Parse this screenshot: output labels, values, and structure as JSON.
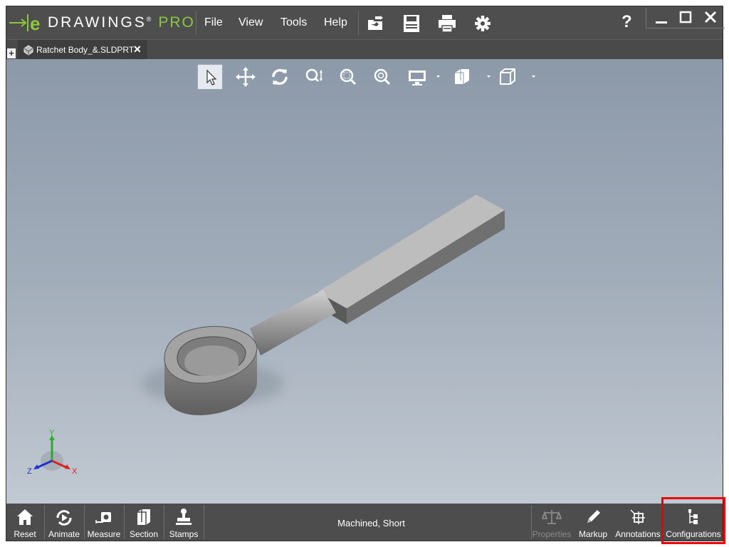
{
  "app": {
    "brand_word": "DRAWINGS",
    "brand_edition": "PRO",
    "registered_mark": "®",
    "accent_color": "#8dc63f"
  },
  "menu": {
    "file": "File",
    "view": "View",
    "tools": "Tools",
    "help": "Help"
  },
  "toolbar_icons": [
    "open-icon",
    "save-icon",
    "print-icon",
    "gear-icon"
  ],
  "help_label": "?",
  "tabs": [
    {
      "label": "Ratchet Body_&.SLDPRT",
      "close": "✕"
    }
  ],
  "new_tab_label": "+",
  "view_tools": [
    "select-icon",
    "pan-icon",
    "rotate-icon",
    "zoom-icon",
    "zoom-to-area-icon",
    "zoom-to-fit-icon",
    "display-style-icon",
    "section-view-icon",
    "standard-views-icon"
  ],
  "triad": {
    "x": "X",
    "y": "Y",
    "z": "Z"
  },
  "bottom_left": [
    {
      "label": "Reset",
      "icon": "home-icon"
    },
    {
      "label": "Animate",
      "icon": "animate-icon"
    },
    {
      "label": "Measure",
      "icon": "measure-icon"
    },
    {
      "label": "Section",
      "icon": "section-icon"
    },
    {
      "label": "Stamps",
      "icon": "stamp-icon"
    }
  ],
  "status_text": "Machined, Short",
  "bottom_right": [
    {
      "label": "Properties",
      "icon": "scale-icon",
      "disabled": true
    },
    {
      "label": "Markup",
      "icon": "pencil-icon"
    },
    {
      "label": "Annotations",
      "icon": "annotation-icon"
    },
    {
      "label": "Configurations",
      "icon": "configurations-icon"
    }
  ],
  "highlight_color": "#e00000"
}
